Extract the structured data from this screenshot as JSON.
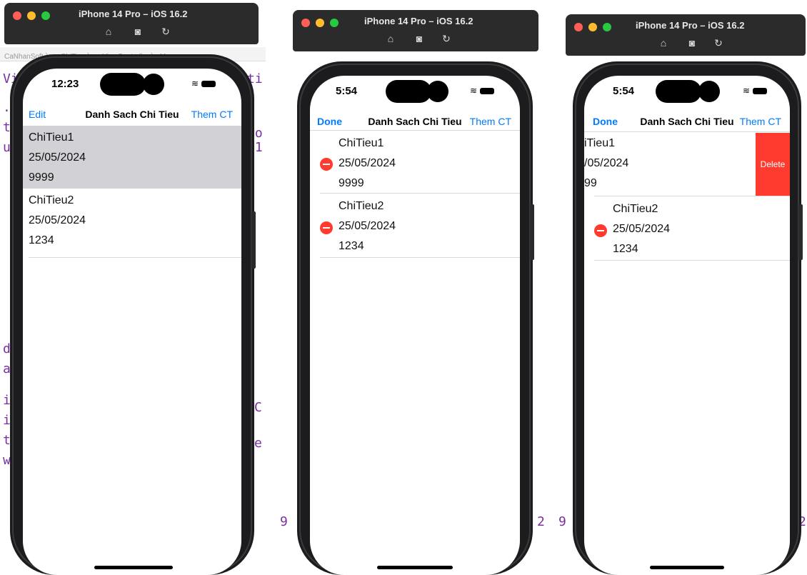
{
  "simulator": {
    "title": "iPhone 14 Pro – iOS 16.2"
  },
  "panels": [
    {
      "id": "p1",
      "time": "12:23",
      "nav": {
        "left": "Edit",
        "title": "Danh Sach Chi Tieu",
        "right": "Them CT"
      },
      "breadcrumb": "CaNhanSoft 〉 ■ ChiTieu 〉 ■ ViewController 〉 M",
      "rows": [
        {
          "title": "ChiTieu1",
          "date": "25/05/2024",
          "amount": "9999"
        },
        {
          "title": "ChiTieu2",
          "date": "25/05/2024",
          "amount": "1234"
        }
      ]
    },
    {
      "id": "p2",
      "time": "5:54",
      "nav": {
        "left": "Done",
        "title": "Danh Sach Chi Tieu",
        "right": "Them CT"
      },
      "rows": [
        {
          "title": "ChiTieu1",
          "date": "25/05/2024",
          "amount": "9999"
        },
        {
          "title": "ChiTieu2",
          "date": "25/05/2024",
          "amount": "1234"
        }
      ]
    },
    {
      "id": "p3",
      "time": "5:54",
      "nav": {
        "left": "Done",
        "title": "Danh Sach Chi Tieu",
        "right": "Them CT"
      },
      "delete_label": "Delete",
      "rows": [
        {
          "title": "iTieu1",
          "date": "/05/2024",
          "amount": "99"
        },
        {
          "title": "ChiTieu2",
          "date": "25/05/2024",
          "amount": "1234"
        }
      ]
    }
  ],
  "colors": {
    "accent": "#007aff",
    "delete": "#ff3b30",
    "selected_row": "#d1d1d6"
  }
}
